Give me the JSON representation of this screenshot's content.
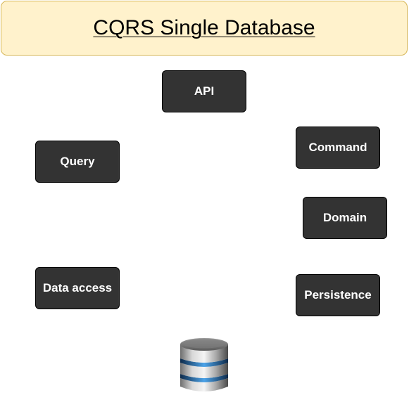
{
  "title": "CQRS Single Database",
  "nodes": {
    "api": "API",
    "command": "Command",
    "query": "Query",
    "domain": "Domain",
    "data_access": "Data access",
    "persistence": "Persistence"
  },
  "icons": {
    "database": "database-icon"
  },
  "colors": {
    "title_fill": "#fff2cc",
    "title_border": "#d6b656",
    "node_fill": "#333333",
    "node_text": "#ffffff",
    "db_band": "#3b82c4"
  }
}
